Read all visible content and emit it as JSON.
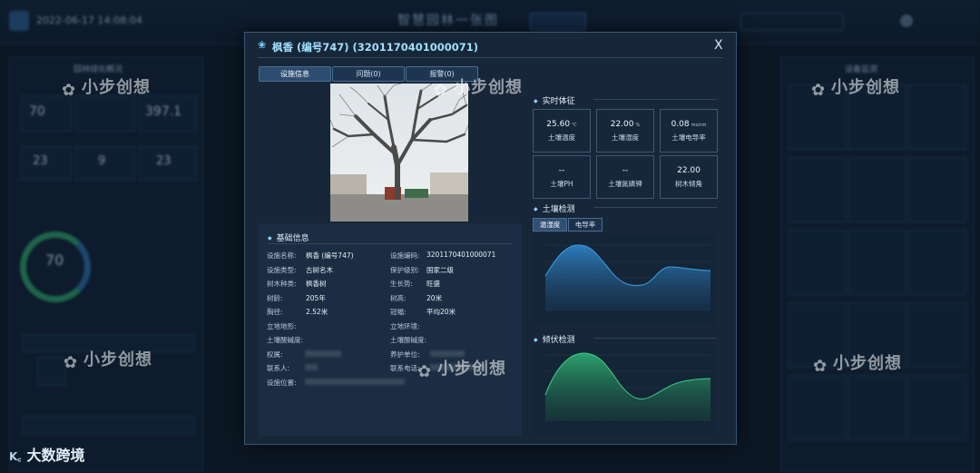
{
  "background": {
    "date": "2022-06-17 14:08:04",
    "header_title": "智慧园林一张图",
    "left_panel_title": "园林绿化概况",
    "left_stats": [
      "70",
      "397.1",
      "23",
      "9",
      "23"
    ],
    "ring_value": "70",
    "right_panel_title": "设备监测"
  },
  "modal": {
    "title": "枫香 (编号747) (3201170401000071)",
    "close_label": "X",
    "tabs": [
      "设施信息",
      "问题(0)",
      "报警(0)"
    ],
    "basic": {
      "title": "基础信息",
      "rows": [
        {
          "k1": "设施名称:",
          "v1": "枫香 (编号747)",
          "k2": "设施编码:",
          "v2": "3201170401000071"
        },
        {
          "k1": "设施类型:",
          "v1": "古树名木",
          "k2": "保护级别:",
          "v2": "国家二级"
        },
        {
          "k1": "树木种类:",
          "v1": "枫香树",
          "k2": "生长势:",
          "v2": "旺盛"
        },
        {
          "k1": "树龄:",
          "v1": "205年",
          "k2": "树高:",
          "v2": "20米"
        },
        {
          "k1": "胸径:",
          "v1": "2.52米",
          "k2": "冠幅:",
          "v2": "平均20米"
        },
        {
          "k1": "立地地形:",
          "v1": "",
          "k2": "立地环境:",
          "v2": ""
        },
        {
          "k1": "土壤酸碱度:",
          "v1": "",
          "k2": "土壤酸碱度:",
          "v2": ""
        },
        {
          "k1": "权属:",
          "v1": "",
          "k2": "养护单位:",
          "v2": ""
        },
        {
          "k1": "联系人:",
          "v1": "",
          "k2": "联系电话:",
          "v2": ""
        },
        {
          "k1": "设施位置:",
          "v1": "",
          "k2": "",
          "v2": ""
        }
      ]
    },
    "vitals": {
      "title": "实时体征",
      "cards": [
        {
          "value": "25.60",
          "unit": "℃",
          "label": "土壤温度"
        },
        {
          "value": "22.00",
          "unit": "%",
          "label": "土壤湿度"
        },
        {
          "value": "0.08",
          "unit": "ms/cm",
          "label": "土壤电导率"
        },
        {
          "value": "--",
          "unit": "",
          "label": "土壤PH"
        },
        {
          "value": "--",
          "unit": "",
          "label": "土壤氮磷钾"
        },
        {
          "value": "22.00",
          "unit": "",
          "label": "树木倾角"
        }
      ]
    },
    "soil": {
      "title": "土壤检测",
      "buttons": [
        "温湿度",
        "电导率"
      ]
    },
    "tilt": {
      "title": "倾伏检测"
    }
  },
  "watermark": "小步创想",
  "brand": "大数跨境",
  "colors": {
    "soil_area": "#2c7fc0",
    "tilt_area": "#2b9a66",
    "modal_bg": "#172638"
  }
}
